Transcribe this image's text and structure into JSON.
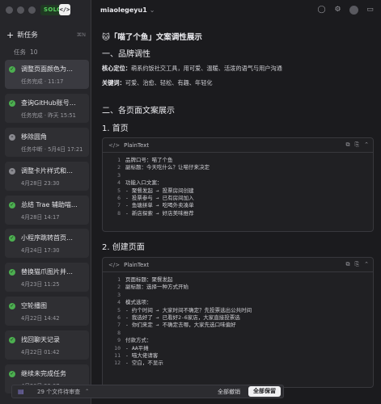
{
  "app": {
    "badge": "SOLO",
    "badge_icon": "</>"
  },
  "sidebar": {
    "new_task_label": "新任务",
    "new_task_shortcut": "⌘N",
    "tasks_label": "任务",
    "tasks_count": "10",
    "tasks": [
      {
        "title": "调整页面颜色为…",
        "subtitle": "任务完成 · 11:17",
        "status": "done",
        "active": true
      },
      {
        "title": "查询GitHub账号…",
        "subtitle": "任务完成 · 昨天 15:51",
        "status": "done",
        "active": false
      },
      {
        "title": "移除圆角",
        "subtitle": "任务中断 · 5月4日 17:21",
        "status": "stopped",
        "active": false
      },
      {
        "title": "调整卡片样式和…",
        "subtitle": "4月28日 23:30",
        "status": "stopped",
        "active": false
      },
      {
        "title": "总结 Trae 辅助喵…",
        "subtitle": "4月28日 14:17",
        "status": "done",
        "active": false
      },
      {
        "title": "小程序跳转首页…",
        "subtitle": "4月24日 17:30",
        "status": "done",
        "active": false
      },
      {
        "title": "替换猫爪图片并…",
        "subtitle": "4月23日 11:25",
        "status": "done",
        "active": false
      },
      {
        "title": "空轮播图",
        "subtitle": "4月22日 14:42",
        "status": "done",
        "active": false
      },
      {
        "title": "找回聊天记录",
        "subtitle": "4月22日 01:42",
        "status": "done",
        "active": false
      },
      {
        "title": "继续未完成任务",
        "subtitle": "4月20日 23:07",
        "status": "done",
        "active": false
      }
    ]
  },
  "topbar": {
    "workspace": "miaolegeyu1"
  },
  "doc": {
    "title": "🐱「喵了个鱼」文案调性展示",
    "section1": "一、品牌调性",
    "positioning_label": "核心定位：",
    "positioning_text": "萌系约饭社交工具，用可爱、温暖、活泼的语气与用户沟通",
    "keywords_label": "关键词：",
    "keywords_text": "可爱、治愈、轻松、有趣、年轻化",
    "section2": "二、各页面文案展示",
    "sub1": "1. 首页",
    "sub2": "2. 创建页面",
    "code1": {
      "lang": "PlainText",
      "lines": [
        "品牌口号：喵了个鱼",
        "副标题：今天吃什么？让喵仔来决定",
        "",
        "功能入口文案：",
        "- 聚餐发起 → 投票房间创建",
        "- 投票参与 → 已有房间加入",
        "- 鱼塘拼单 → 吃喝外卖凑单",
        "- 新店探索 → 好店美味推荐"
      ]
    },
    "code2": {
      "lang": "PlainText",
      "lines": [
        "页面标题：聚餐发起",
        "副标题：选择一种方式开始",
        "",
        "模式选项：",
        "- 约个时间 → 大家时间不确定？先投票选出公共时间",
        "- 我选好了 → 已看好2-6家店，大家直接投票选",
        "- 你们来定 → 不确定去哪，大家先选口味偏好",
        "",
        "付款方式：",
        "- AA平摊",
        "- 喵大佬请客",
        "- 空白，不显示"
      ]
    }
  },
  "bottombar": {
    "pending": "29 个文件待审查",
    "revoke": "全部撤销",
    "keep": "全部保留"
  },
  "colors": {
    "success": "#4caf50",
    "stopped": "#8a8a90",
    "badge_green": "#58d05e"
  }
}
